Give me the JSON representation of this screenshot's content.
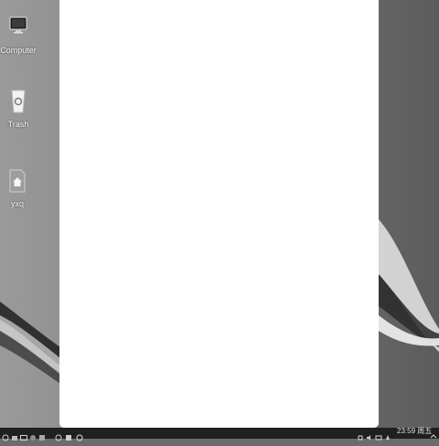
{
  "desktop": {
    "icons": [
      {
        "name": "computer-icon",
        "label": "Computer"
      },
      {
        "name": "trash-icon",
        "label": "Trash"
      },
      {
        "name": "home-folder-icon",
        "label": "yxq"
      }
    ]
  },
  "taskbar": {
    "launcher_icons": [
      "launcher-icon",
      "file-manager-icon",
      "terminal-icon",
      "browser-icon",
      "app-icon",
      "app-icon",
      "app-icon",
      "app-icon"
    ],
    "tray_icons": [
      "network-icon",
      "volume-icon",
      "keyboard-icon",
      "notification-icon",
      "wifi-icon"
    ],
    "clock": "23:59 周五"
  },
  "colors": {
    "window_bg": "#ffffff",
    "taskbar_bg": "#202020"
  }
}
